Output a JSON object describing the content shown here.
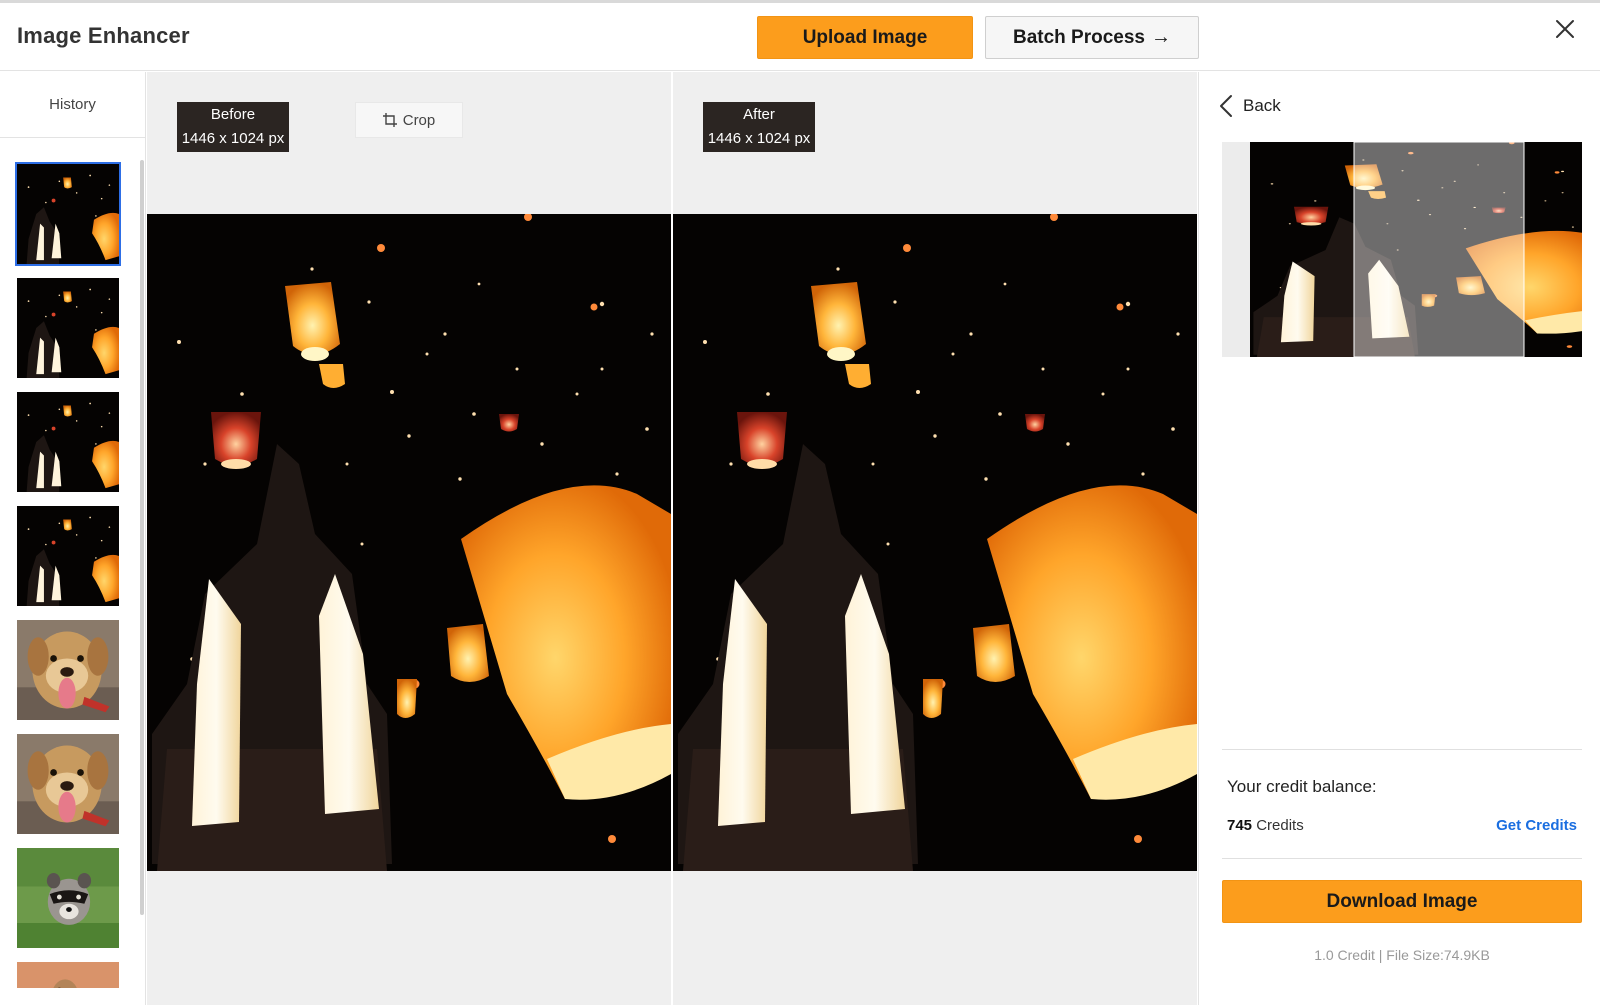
{
  "app": {
    "title": "Image Enhancer"
  },
  "header": {
    "upload_label": "Upload Image",
    "batch_label": "Batch Process",
    "batch_arrow": "→"
  },
  "sidebar": {
    "title": "History",
    "items": [
      {
        "subject": "lanterns",
        "selected": true
      },
      {
        "subject": "lanterns",
        "selected": false
      },
      {
        "subject": "lanterns",
        "selected": false
      },
      {
        "subject": "lanterns",
        "selected": false
      },
      {
        "subject": "dog",
        "selected": false
      },
      {
        "subject": "dog",
        "selected": false
      },
      {
        "subject": "raccoon",
        "selected": false
      },
      {
        "subject": "meerkat",
        "selected": false
      }
    ]
  },
  "compare": {
    "before_label": "Before",
    "before_size": "1446 x 1024 px",
    "after_label": "After",
    "after_size": "1446 x 1024 px",
    "crop_label": "Crop"
  },
  "panel": {
    "back_label": "Back",
    "credit_balance_label": "Your credit balance:",
    "credit_count": "745",
    "credit_unit": "Credits",
    "get_credits_label": "Get Credits",
    "download_label": "Download Image",
    "file_info": "1.0 Credit | File Size:74.9KB"
  },
  "colors": {
    "accent": "#fc9d1c",
    "link": "#1a6ee0",
    "selected_border": "#2d6ee6",
    "tag_bg": "#2b2522"
  },
  "icons": {
    "close": "close-icon",
    "crop": "crop-icon",
    "back": "chevron-left-icon",
    "arrow": "arrow-right-icon"
  }
}
